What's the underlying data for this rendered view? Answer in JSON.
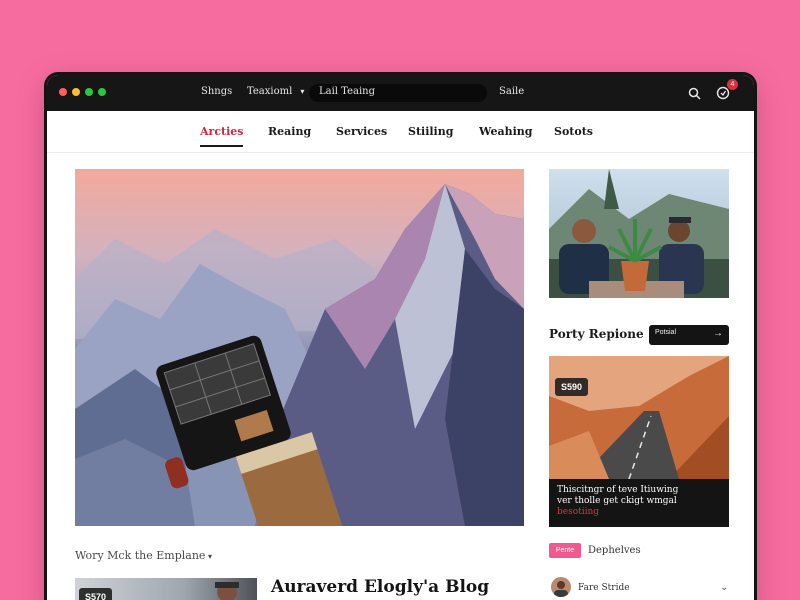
{
  "titlebar": {
    "dots": [
      {
        "name": "close",
        "color": "#ff5f57"
      },
      {
        "name": "minimize",
        "color": "#febc2e"
      },
      {
        "name": "maximize",
        "color": "#28c840"
      },
      {
        "name": "extra",
        "color": "#28c840"
      }
    ],
    "items": [
      "Shngs",
      "Teaxioml",
      "Saile"
    ],
    "address": "Lail Teaing",
    "search_icon": "search-icon",
    "notification_icon": "notification-icon",
    "notification_count": "4"
  },
  "nav": {
    "items": [
      "Arcties",
      "Reaing",
      "Services",
      "Stiiling",
      "Weahing",
      "Sotots"
    ],
    "active": "Arcties",
    "accent_color": "#d4263c"
  },
  "sidebar": {
    "section_title": "Porty Repione",
    "mini_search_text": "Potsial",
    "road_card": {
      "tag": "S590",
      "caption_line1": "Thiscitngr of teve Itiuwing",
      "caption_line2": "ver tholle get ckigt wmgal",
      "caption_accent": "besotiing"
    },
    "pill": "Pente",
    "pill_label": "Dephelves",
    "author_name": "Fare Stride"
  },
  "main": {
    "byline": "Wory Mck the Emplane",
    "bottom_tag": "S570",
    "bottom_title": "Auraverd Elogly'a Blog"
  },
  "colors": {
    "background": "#f76c9f",
    "titlebar": "#161616",
    "accent": "#d4263c",
    "pink": "#f05a8c"
  }
}
